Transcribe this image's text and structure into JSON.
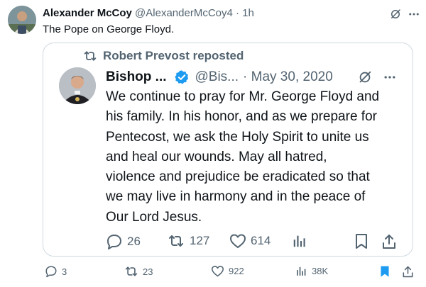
{
  "tweet": {
    "author_name": "Alexander McCoy",
    "author_handle": "@AlexanderMcCoy4",
    "time": "· 1h",
    "text": "The Pope on George Floyd."
  },
  "quote": {
    "reposted_by": "Robert Prevost reposted",
    "author_name": "Bishop ...",
    "author_handle": "@Bis...",
    "date": "· May 30, 2020",
    "text_lines": [
      "We continue to pray for Mr. George Floyd and",
      "his family. In his honor, and as we prepare for",
      "Pentecost, we ask the Holy Spirit to unite us",
      "and heal our wounds. May all hatred,",
      "violence and prejudice be eradicated so that",
      "we may live in harmony and in the peace of",
      "Our Lord Jesus."
    ],
    "replies": "26",
    "reposts": "127",
    "likes": "614"
  },
  "actions": {
    "replies": "3",
    "reposts": "23",
    "likes": "922",
    "views": "38K"
  },
  "colors": {
    "verified_badge": "#1d9bf0",
    "bookmark_filled": "#1d9bf0",
    "muted_text": "#536471",
    "border": "#cfd9de"
  },
  "icons": [
    "grok-icon",
    "more-icon",
    "repost-icon",
    "verified-badge-icon",
    "reply-icon",
    "like-icon",
    "views-icon",
    "bookmark-icon",
    "share-icon"
  ]
}
